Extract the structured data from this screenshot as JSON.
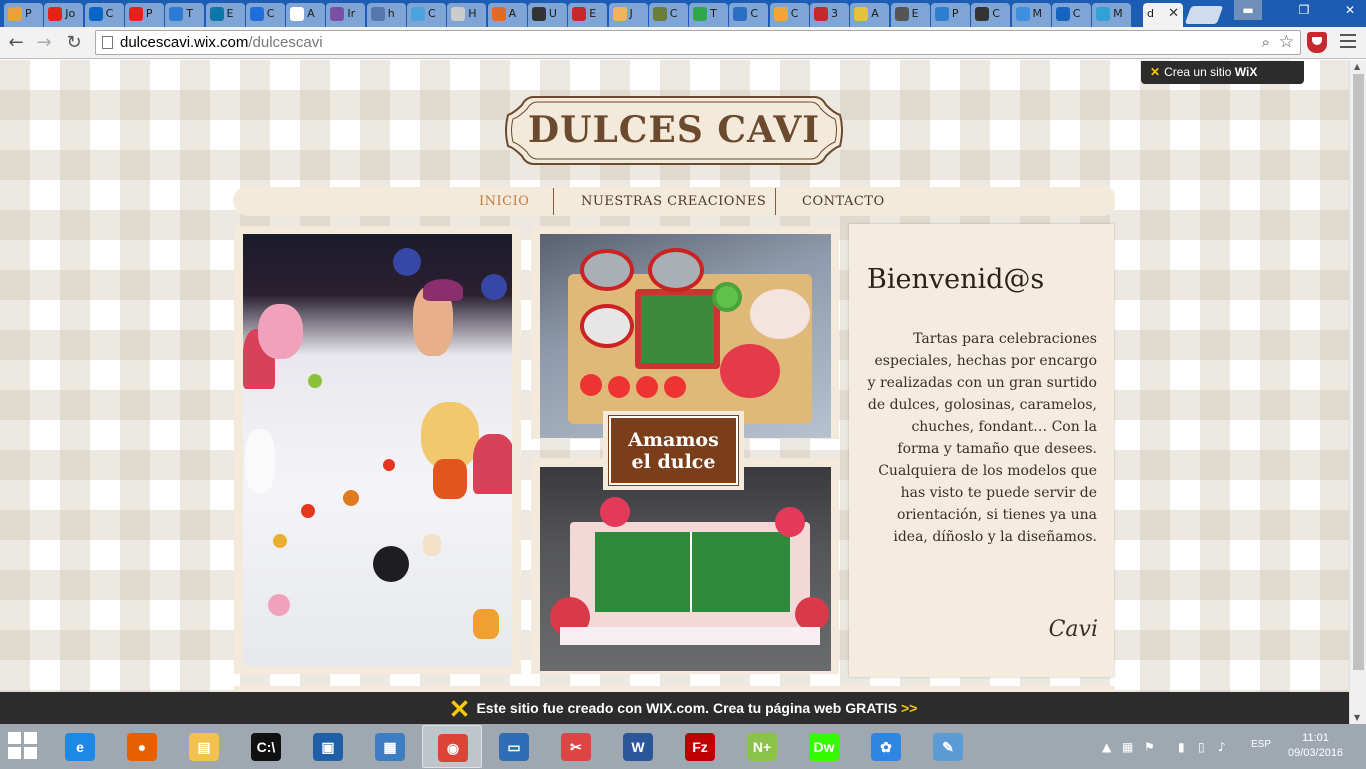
{
  "browser": {
    "tabs": [
      {
        "label": "P",
        "color": "#e8a33c"
      },
      {
        "label": "Jo",
        "color": "#e62117"
      },
      {
        "label": "C",
        "color": "#0a64c8"
      },
      {
        "label": "P",
        "color": "#e62117"
      },
      {
        "label": "T",
        "color": "#2c7bd6"
      },
      {
        "label": "E",
        "color": "#0e76a8"
      },
      {
        "label": "C",
        "color": "#1e6fd9"
      },
      {
        "label": "A",
        "color": "#ffffff"
      },
      {
        "label": "Ir",
        "color": "#7b4fa3"
      },
      {
        "label": "h",
        "color": "#5577aa"
      },
      {
        "label": "C",
        "color": "#4aa3df"
      },
      {
        "label": "H",
        "color": "#cccccc"
      },
      {
        "label": "A",
        "color": "#e06a2a"
      },
      {
        "label": "U",
        "color": "#333333"
      },
      {
        "label": "E",
        "color": "#c6282c"
      },
      {
        "label": "J",
        "color": "#f2b25c"
      },
      {
        "label": "C",
        "color": "#6b7d3b"
      },
      {
        "label": "T",
        "color": "#2ea84a"
      },
      {
        "label": "C",
        "color": "#2b6fc4"
      },
      {
        "label": "C",
        "color": "#f2a63a"
      },
      {
        "label": "3",
        "color": "#c6282c"
      },
      {
        "label": "A",
        "color": "#e4c23a"
      },
      {
        "label": "E",
        "color": "#555555"
      },
      {
        "label": "P",
        "color": "#2e7dd1"
      },
      {
        "label": "C",
        "color": "#333333"
      },
      {
        "label": "M",
        "color": "#3d8fe0"
      },
      {
        "label": "C",
        "color": "#1565c0"
      },
      {
        "label": "M",
        "color": "#31a1d8"
      }
    ],
    "active_tab": {
      "label": "d",
      "close": "✕"
    },
    "url_host": "dulcescavi.wix.com",
    "url_path": "/dulcescavi",
    "window_buttons": {
      "minimize": "▬",
      "maximize": "❐",
      "close": "✕"
    }
  },
  "site": {
    "wix_badge_prefix": "Crea un sitio",
    "wix_badge_brand": "WiX",
    "logo_text": "DULCES CAVI",
    "nav": [
      "INICIO",
      "NUESTRAS CREACIONES",
      "CONTACTO"
    ],
    "caption_line1": "Amamos",
    "caption_line2": "el dulce",
    "welcome_title": "Bienvenid@s",
    "welcome_text": "Tartas para celebraciones especiales, hechas por encargo y realizadas con un gran surtido de dulces, golosinas, caramelos, chuches, fondant… Con la forma y tamaño que desees. Cualquiera de los modelos que has visto te puede servir de orientación, si tienes ya una idea, díñoslo y la diseñamos.",
    "welcome_sign": "Cavi",
    "footer_text": "Este sitio fue creado con WIX.com. Crea tu página web GRATIS",
    "footer_arrow": ">>"
  },
  "taskbar": {
    "apps": [
      {
        "name": "internet-explorer",
        "glyph": "e",
        "color": "#1e88e5"
      },
      {
        "name": "firefox",
        "glyph": "●",
        "color": "#e66000"
      },
      {
        "name": "file-explorer",
        "glyph": "▤",
        "color": "#f2c14e"
      },
      {
        "name": "command-prompt",
        "glyph": "C:\\",
        "color": "#111111"
      },
      {
        "name": "virtualbox",
        "glyph": "▣",
        "color": "#1f5fa8"
      },
      {
        "name": "control-panel",
        "glyph": "▦",
        "color": "#3c7dc4"
      },
      {
        "name": "chrome",
        "glyph": "◉",
        "color": "#db4437"
      },
      {
        "name": "remote-desktop",
        "glyph": "▭",
        "color": "#2f6db5"
      },
      {
        "name": "snipping-tool",
        "glyph": "✂",
        "color": "#d44"
      },
      {
        "name": "word",
        "glyph": "W",
        "color": "#2b579a"
      },
      {
        "name": "filezilla",
        "glyph": "Fz",
        "color": "#bf0000"
      },
      {
        "name": "notepad-plus",
        "glyph": "N+",
        "color": "#8bc34a"
      },
      {
        "name": "dreamweaver",
        "glyph": "Dw",
        "color": "#35fa00"
      },
      {
        "name": "app-flower",
        "glyph": "✿",
        "color": "#2f86e0"
      },
      {
        "name": "paint",
        "glyph": "✎",
        "color": "#5a9bd5"
      }
    ],
    "lang": "ESP",
    "time": "11:01",
    "date": "09/03/2016"
  }
}
